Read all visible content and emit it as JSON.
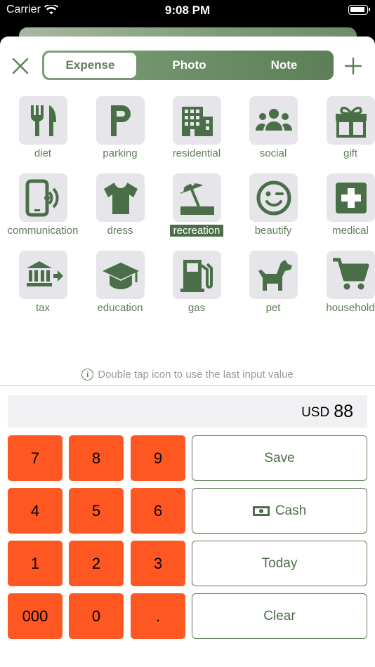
{
  "status": {
    "carrier": "Carrier",
    "time": "9:08 PM"
  },
  "tabs": [
    {
      "label": "Expense",
      "active": true
    },
    {
      "label": "Photo",
      "active": false
    },
    {
      "label": "Note",
      "active": false
    }
  ],
  "categories": [
    {
      "label": "diet",
      "icon": "fork-knife-icon"
    },
    {
      "label": "parking",
      "icon": "parking-icon"
    },
    {
      "label": "residential",
      "icon": "building-icon"
    },
    {
      "label": "social",
      "icon": "people-group-icon"
    },
    {
      "label": "gift",
      "icon": "gift-icon"
    },
    {
      "label": "communication",
      "icon": "phone-signal-icon"
    },
    {
      "label": "dress",
      "icon": "tshirt-icon"
    },
    {
      "label": "recreation",
      "icon": "beach-umbrella-icon",
      "selected": true
    },
    {
      "label": "beautify",
      "icon": "wink-face-icon"
    },
    {
      "label": "medical",
      "icon": "medical-cross-icon"
    },
    {
      "label": "tax",
      "icon": "bank-arrow-icon"
    },
    {
      "label": "education",
      "icon": "graduation-cap-icon"
    },
    {
      "label": "gas",
      "icon": "gas-pump-icon"
    },
    {
      "label": "pet",
      "icon": "dog-icon"
    },
    {
      "label": "household",
      "icon": "shopping-cart-icon"
    }
  ],
  "hint": "Double tap icon to use the last input value",
  "display": {
    "currency": "USD",
    "amount": "88"
  },
  "keys": [
    "7",
    "8",
    "9",
    "4",
    "5",
    "6",
    "1",
    "2",
    "3",
    "000",
    "0",
    "."
  ],
  "actions": {
    "save": "Save",
    "cash": "Cash",
    "today": "Today",
    "clear": "Clear"
  },
  "colors": {
    "accent": "#5d7f57",
    "key": "#fe5722",
    "tile": "#e6e6ea"
  }
}
